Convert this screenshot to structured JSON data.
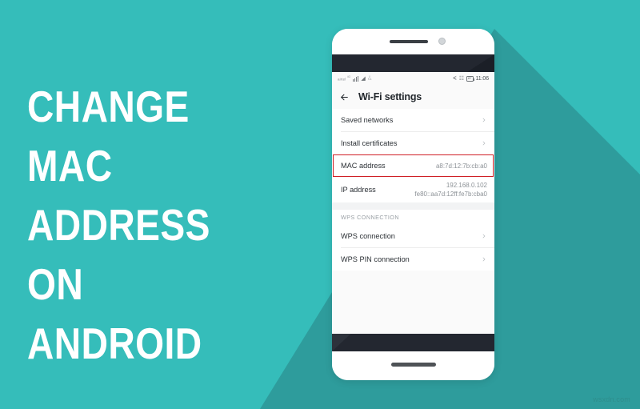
{
  "poster": {
    "headline": "CHANGE MAC\nADDRESS ON\nANDROID",
    "background_color": "#35bdba",
    "shadow_color": "#2e9c9c",
    "headline_color": "#ffffff",
    "watermark": "wsxdn.com"
  },
  "phone": {
    "status_bar": {
      "carrier": "airtel",
      "network_type": "4G",
      "data_rate_value": "0",
      "data_rate_unit": "K/s",
      "bluetooth_icon": "bluetooth-icon",
      "silent_icon": "vibrate-icon",
      "battery_percent": "87",
      "time": "11:06"
    },
    "app_bar": {
      "back_icon": "back-arrow-icon",
      "title": "Wi-Fi settings"
    },
    "list": {
      "rows": [
        {
          "label": "Saved networks",
          "value": "",
          "value2": "",
          "chevron": true
        },
        {
          "label": "Install certificates",
          "value": "",
          "value2": "",
          "chevron": true
        },
        {
          "label": "MAC address",
          "value": "a8:7d:12:7b:cb:a0",
          "value2": "",
          "chevron": false,
          "highlighted": true
        },
        {
          "label": "IP address",
          "value": "192.168.0.102",
          "value2": "fe80::aa7d:12ff:fe7b:cba0",
          "chevron": false
        }
      ],
      "section_title": "WPS CONNECTION",
      "wps_rows": [
        {
          "label": "WPS connection",
          "chevron": true
        },
        {
          "label": "WPS PIN connection",
          "chevron": true
        }
      ]
    },
    "highlight_color": "#cf2026"
  }
}
